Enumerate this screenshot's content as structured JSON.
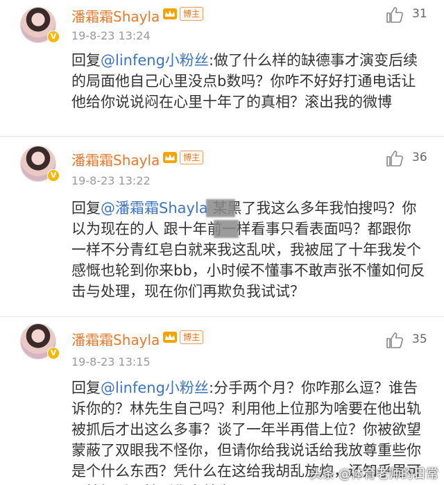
{
  "comments": [
    {
      "username": "潘霜霜Shayla",
      "role_badge": "博主",
      "time": "19-8-23 13:24",
      "likes": "31",
      "reply_prefix": "回复",
      "mention": "@linfeng小粉丝",
      "text": ":做了什么样的缺德事才演变后续的局面他自己心里没点b数吗？你咋不好好打通电话让他给你说说闷在心里十年了的真相？滚出我的微博"
    },
    {
      "username": "潘霜霜Shayla",
      "role_badge": "博主",
      "time": "19-8-23 13:22",
      "likes": "36",
      "reply_prefix": "回复",
      "mention": "@潘霜霜Shayla",
      "text": " 某黑了我这么多年我怕搜吗？你以为现在的人 跟十年前一样看事只看表面吗？都跟你一样不分青红皂白就来我这乱吠，我被屈了十年我发个感慨也轮到你来bb，小时候不懂事不敢声张不懂如何反击与处理，现在你们再欺负我试试？"
    },
    {
      "username": "潘霜霜Shayla",
      "role_badge": "博主",
      "time": "19-8-23 13:15",
      "likes": "35",
      "reply_prefix": "回复",
      "mention": "@linfeng小粉丝",
      "text": ":分手两个月？你咋那么逗？谁告诉你的？林先生自己吗？利用他上位那为啥要在他出轨被抓后才出这么多事？谈了一年半再借上位？你被欲望蒙蔽了双眼我不怪你，但请你给我说话给我放尊重些你是个什么东西？凭什么在这给我胡乱放炮，还知乎里可以搜知乎里搜到你家林先"
    }
  ],
  "watermark": "头条 @体育老师的日常",
  "colors": {
    "username": "#e8782a",
    "mention": "#3b74c4",
    "time": "#999999",
    "text": "#333333"
  },
  "icons": {
    "like": "thumbs-up-icon",
    "verified": "verified-v-icon",
    "vip": "vip-crown-icon"
  }
}
